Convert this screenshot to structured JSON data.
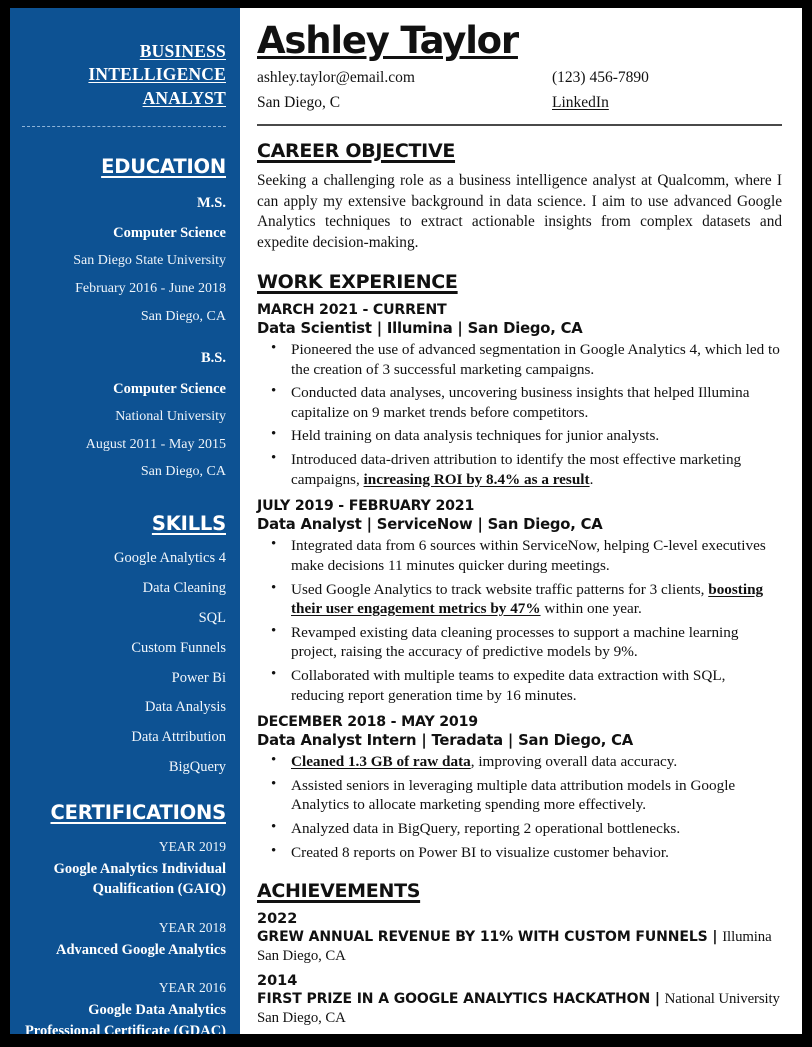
{
  "sidebar": {
    "job_title": "BUSINESS INTELLIGENCE ANALYST",
    "education_heading": "EDUCATION",
    "education": [
      {
        "degree": "M.S.",
        "major": "Computer Science",
        "school": "San Diego State University",
        "dates": "February 2016  -  June  2018",
        "location": "San Diego, CA"
      },
      {
        "degree": "B.S.",
        "major": "Computer Science",
        "school": "National University",
        "dates": "August 2011 - May 2015",
        "location": "San Diego, CA"
      }
    ],
    "skills_heading": "SKILLS",
    "skills": [
      "Google Analytics 4",
      "Data Cleaning",
      "SQL",
      "Custom Funnels",
      "Power Bi",
      "Data Analysis",
      "Data Attribution",
      "BigQuery"
    ],
    "certifications_heading": "CERTIFICATIONS",
    "certifications": [
      {
        "year": "YEAR 2019",
        "name": "Google Analytics Individual Qualification (GAIQ)"
      },
      {
        "year": "YEAR 2018",
        "name": "Advanced Google Analytics"
      },
      {
        "year": "YEAR 2016",
        "name": "Google Data Analytics Professional Certificate (GDAC)"
      }
    ]
  },
  "header": {
    "name": "Ashley Taylor",
    "email": "ashley.taylor@email.com",
    "phone": "(123) 456-7890",
    "location": "San Diego, C",
    "linkedin": "LinkedIn"
  },
  "objective": {
    "heading": "CAREER OBJECTIVE ",
    "text": "Seeking a challenging role as a business intelligence analyst at Qualcomm, where I can apply my extensive background in data science. I aim to use advanced Google Analytics techniques to extract actionable insights from complex datasets and expedite decision-making."
  },
  "work": {
    "heading": "WORK EXPERIENCE",
    "jobs": [
      {
        "dates": "MARCH 2021 - CURRENT",
        "line": "Data Scientist | Illumina | San Diego, CA",
        "bullets": [
          {
            "pre": "Pioneered the use of advanced segmentation in Google Analytics 4, which led to the creation of 3 successful marketing campaigns.",
            "bold": "",
            "post": ""
          },
          {
            "pre": "Conducted data analyses, uncovering business insights that helped Illumina capitalize on 9 market trends before competitors.",
            "bold": "",
            "post": ""
          },
          {
            "pre": "Held training on data analysis techniques for junior analysts.",
            "bold": "",
            "post": ""
          },
          {
            "pre": "Introduced data-driven attribution to identify the most effective marketing campaigns, ",
            "bold": "increasing ROI by 8.4% as a result",
            "post": "."
          }
        ]
      },
      {
        "dates": "JULY 2019 - FEBRUARY 2021",
        "line": "Data Analyst | ServiceNow | San Diego, CA",
        "bullets": [
          {
            "pre": "Integrated data from 6 sources within ServiceNow, helping C-level executives make decisions 11 minutes quicker during meetings.",
            "bold": "",
            "post": ""
          },
          {
            "pre": "Used Google Analytics to track website traffic patterns for 3 clients, ",
            "bold": "boosting their user engagement metrics by 47%",
            "post": " within one year."
          },
          {
            "pre": "Revamped existing data cleaning processes to support a machine learning project, raising the accuracy of predictive models by 9%.",
            "bold": "",
            "post": ""
          },
          {
            "pre": "Collaborated with multiple teams to expedite data extraction with SQL, reducing report generation time by 16 minutes.",
            "bold": "",
            "post": ""
          }
        ]
      },
      {
        "dates": "DECEMBER 2018 - MAY 2019",
        "line": "Data Analyst Intern | Teradata | San Diego, CA",
        "bullets": [
          {
            "pre": "",
            "bold": "Cleaned 1.3 GB of raw data",
            "post": ", improving overall data accuracy."
          },
          {
            "pre": "Assisted seniors in leveraging multiple data attribution models in Google Analytics to allocate marketing spending more effectively.",
            "bold": "",
            "post": ""
          },
          {
            "pre": "Analyzed data in BigQuery, reporting 2 operational bottlenecks.",
            "bold": "",
            "post": ""
          },
          {
            "pre": "Created 8 reports on Power BI to visualize customer behavior.",
            "bold": "",
            "post": ""
          }
        ]
      }
    ]
  },
  "achievements": {
    "heading": "ACHIEVEMENTS",
    "items": [
      {
        "year": "2022",
        "title": "GREW ANNUAL REVENUE BY 11% WITH CUSTOM FUNNELS",
        "separator": " | ",
        "org": "Illumina San Diego, CA"
      },
      {
        "year": "2014",
        "title": "FIRST PRIZE IN A GOOGLE ANALYTICS HACKATHON",
        "separator": " | ",
        "org": "National University San Diego, CA"
      }
    ]
  },
  "colors": {
    "sidebar_blue": "#0d5293",
    "border_black": "#000000",
    "rule_gray": "#4a4a4a"
  }
}
